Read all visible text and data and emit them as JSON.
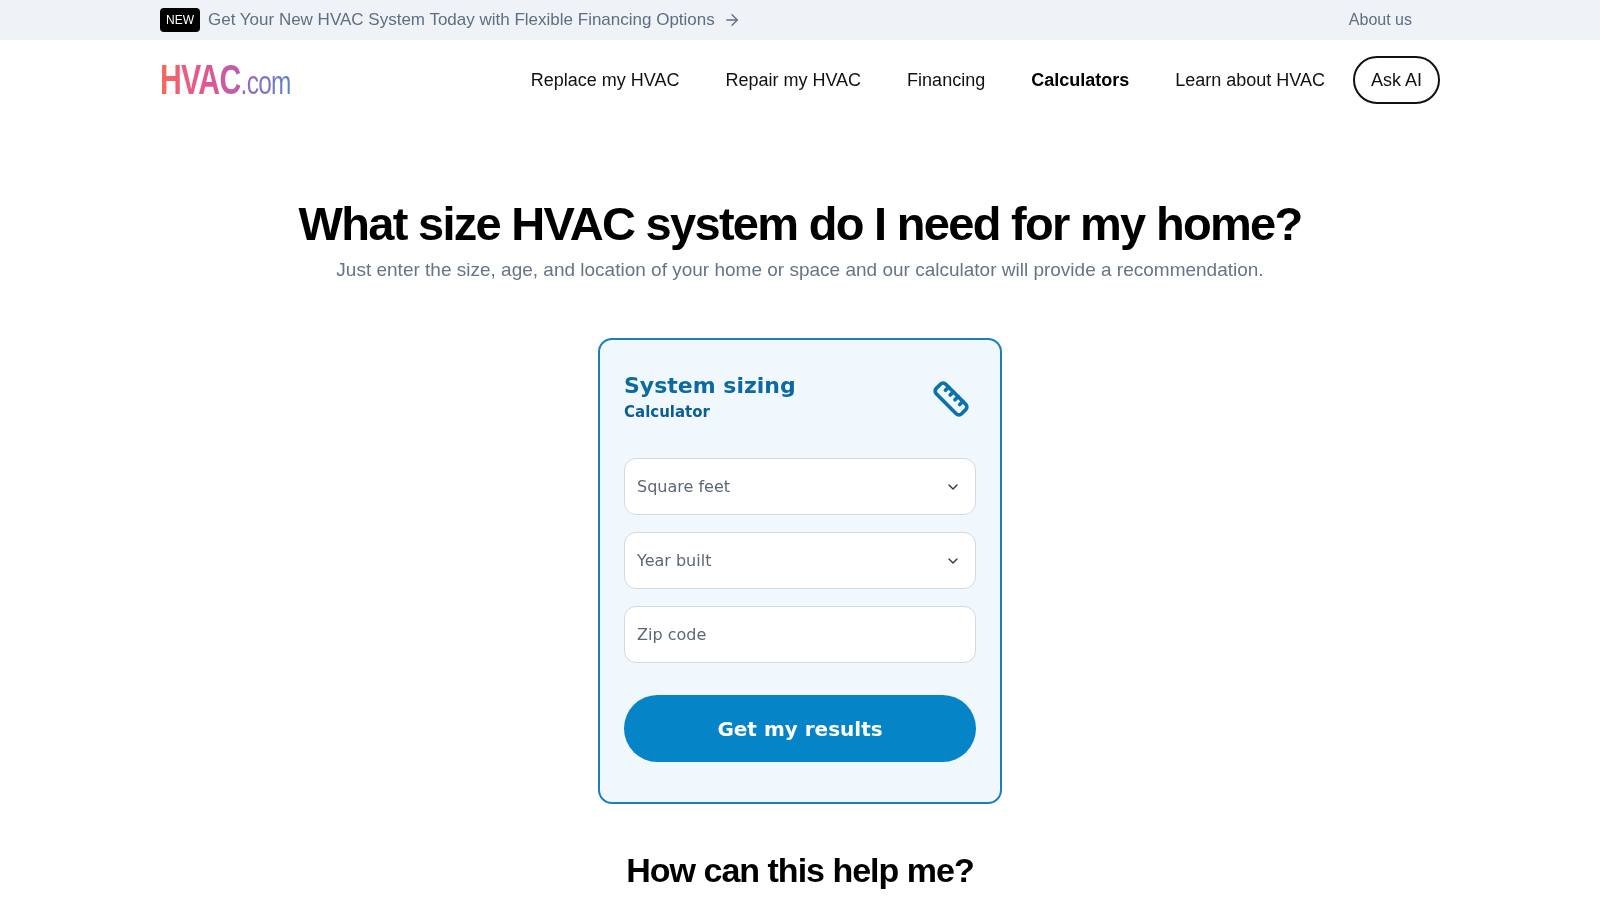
{
  "promo_bar": {
    "badge": "NEW",
    "message": "Get Your New HVAC System Today with Flexible Financing Options",
    "link": "About us"
  },
  "header": {
    "logo": {
      "name": "HVAC",
      "suffix": ".com"
    },
    "nav": [
      {
        "label": "Replace my HVAC",
        "selected": false
      },
      {
        "label": "Repair my HVAC",
        "selected": false
      },
      {
        "label": "Financing",
        "selected": false
      },
      {
        "label": "Calculators",
        "selected": true
      },
      {
        "label": "Learn about HVAC",
        "selected": false
      }
    ],
    "cta": "Ask AI"
  },
  "hero": {
    "title": "What size HVAC system do I need for my home?",
    "subtitle": "Just enter the size, age, and location of your home or space and our calculator will provide a recommendation."
  },
  "calculator": {
    "title": "System sizing",
    "subtitle": "Calculator",
    "fields": [
      {
        "kind": "select",
        "placeholder": "Square feet"
      },
      {
        "kind": "select",
        "placeholder": "Year built"
      },
      {
        "kind": "text",
        "placeholder": "Zip code"
      }
    ],
    "submit": "Get my results"
  },
  "next_section": {
    "title": "How can this help me?"
  }
}
